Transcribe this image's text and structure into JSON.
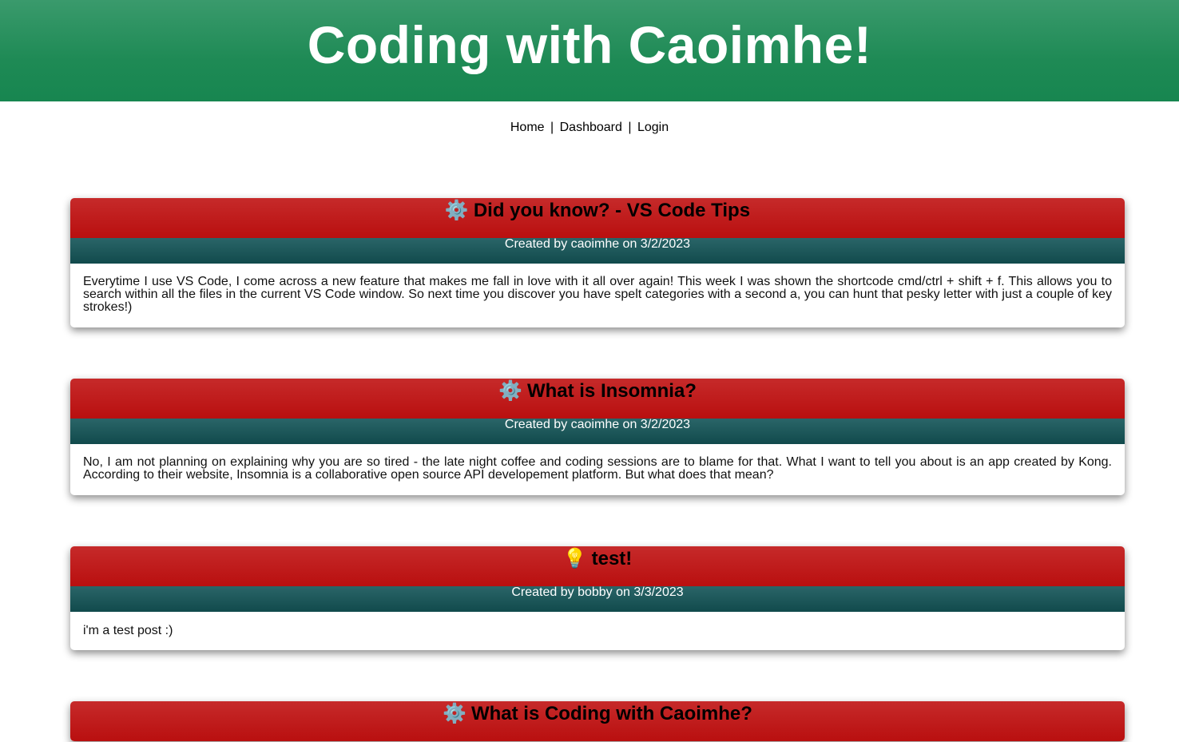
{
  "site": {
    "title": "Coding with Caoimhe!"
  },
  "nav": {
    "home": "Home",
    "separator": "|",
    "dashboard": "Dashboard",
    "login": "Login"
  },
  "posts": [
    {
      "icon": "gear-icon",
      "icon_glyph": "⚙️",
      "title": "Did you know? - VS Code Tips",
      "meta": "Created by caoimhe on 3/2/2023",
      "body": "Everytime I use VS Code, I come across a new feature that makes me fall in love with it all over again! This week I was shown the shortcode cmd/ctrl + shift + f. This allows you to search within all the files in the current VS Code window. So next time you discover you have spelt categories with a second a, you can hunt that pesky letter with just a couple of key strokes!)"
    },
    {
      "icon": "gear-icon",
      "icon_glyph": "⚙️",
      "title": "What is Insomnia?",
      "meta": "Created by caoimhe on 3/2/2023",
      "body": "No, I am not planning on explaining why you are so tired - the late night coffee and coding sessions are to blame for that. What I want to tell you about is an app created by Kong. According to their website, Insomnia is a collaborative open source API developement platform. But what does that mean?"
    },
    {
      "icon": "lightbulb-icon",
      "icon_glyph": "💡",
      "title": "test!",
      "meta": "Created by bobby on 3/3/2023",
      "body": "i'm a test post :)"
    },
    {
      "icon": "gear-icon",
      "icon_glyph": "⚙️",
      "title": "What is Coding with Caoimhe?"
    }
  ],
  "colors": {
    "header_green": "#1e8a55",
    "post_title_red": "#b90f0f",
    "post_meta_teal": "#114a4c"
  }
}
